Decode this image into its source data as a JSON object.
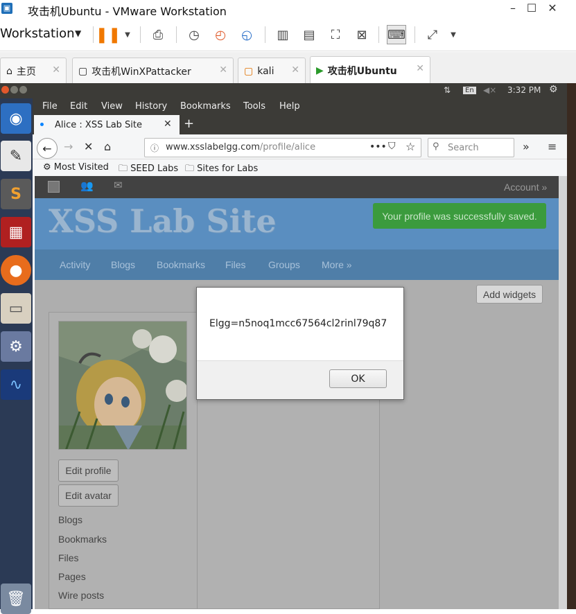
{
  "vmware": {
    "title": "攻击机Ubuntu - VMware Workstation",
    "menu_label": "Workstation",
    "tabs": [
      {
        "label": "主页"
      },
      {
        "label": "攻击机WinXPattacker"
      },
      {
        "label": "kali"
      },
      {
        "label": "攻击机Ubuntu"
      }
    ]
  },
  "ubuntu_panel": {
    "keyboard": "En",
    "time": "3:32 PM"
  },
  "firefox": {
    "menu": [
      "File",
      "Edit",
      "View",
      "History",
      "Bookmarks",
      "Tools",
      "Help"
    ],
    "tab_title": "Alice : XSS Lab Site",
    "url_domain": "www.xsslabelgg.com",
    "url_path": "/profile/alice",
    "search_placeholder": "Search",
    "bookmarks": [
      "Most Visited",
      "SEED Labs",
      "Sites for Labs"
    ]
  },
  "site": {
    "account": "Account »",
    "title": "XSS Lab Site",
    "success_message": "Your profile was successfully saved.",
    "nav": [
      "Activity",
      "Blogs",
      "Bookmarks",
      "Files",
      "Groups",
      "More »"
    ],
    "add_widgets": "Add widgets",
    "edit_profile": "Edit profile",
    "edit_avatar": "Edit avatar",
    "links": [
      "Blogs",
      "Bookmarks",
      "Files",
      "Pages",
      "Wire posts"
    ]
  },
  "dialog": {
    "message": "Elgg=n5noq1mcc67564cl2rinl79q87",
    "ok_label": "OK"
  }
}
